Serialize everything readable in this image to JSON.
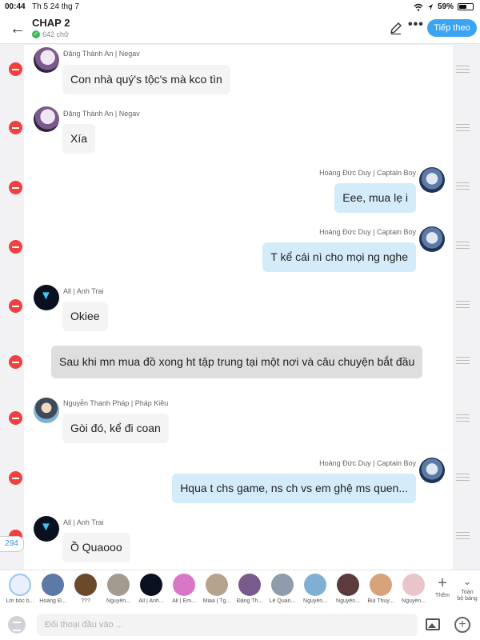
{
  "status_bar": {
    "time": "00:44",
    "date": "Th 5 24 thg 7",
    "battery": "59%",
    "battery_level": 0.59
  },
  "header": {
    "title": "CHAP 2",
    "word_count": "642 chữ",
    "next_button": "Tiếp theo",
    "back_icon": "back-arrow-icon",
    "edit_icon": "pencil-icon",
    "more_icon": "more-dots-icon"
  },
  "messages": [
    {
      "type": "incoming",
      "avatar": "av-a",
      "sender": "Đặng Thành An | Negav",
      "text": "Con nhà quý's tộc's mà kco tìn"
    },
    {
      "type": "incoming",
      "avatar": "av-a",
      "sender": "Đặng Thành An | Negav",
      "text": "Xía"
    },
    {
      "type": "outgoing",
      "avatar": "av-b",
      "sender": "Hoàng Đức Duy | Captain Boy",
      "text": "Eee, mua lẹ i"
    },
    {
      "type": "outgoing",
      "avatar": "av-b",
      "sender": "Hoàng Đức Duy | Captain Boy",
      "text": "T kể cái nì cho mọi ng nghe"
    },
    {
      "type": "incoming",
      "avatar": "av-c",
      "sender": "All | Anh Trai",
      "text": "Okiee"
    },
    {
      "type": "narration",
      "text": "Sau khi mn mua đồ xong ht tập trung tại một nơi và câu chuyện bắt đầu"
    },
    {
      "type": "incoming",
      "avatar": "av-d",
      "sender": "Nguyễn Thanh Pháp | Pháp Kiều",
      "text": "Gòi đó, kể đi coan"
    },
    {
      "type": "outgoing",
      "avatar": "av-b",
      "sender": "Hoàng Đức Duy | Captain Boy",
      "text": "Hqua t chs game, ns ch vs em ghệ ms quen..."
    },
    {
      "type": "incoming",
      "avatar": "av-c",
      "sender": "All | Anh Trai",
      "text": "Ồ Quaooo"
    }
  ],
  "counter": "294",
  "characters": [
    {
      "label": "Lời bốc b...",
      "color": "#e8f1fb"
    },
    {
      "label": "Hoàng Đ...",
      "color": "#5d79a5"
    },
    {
      "label": "???",
      "color": "#6b4a2a"
    },
    {
      "label": "Nguyễn...",
      "color": "#a39a90"
    },
    {
      "label": "All | Anh...",
      "color": "#0b1020"
    },
    {
      "label": "All | Em...",
      "color": "#d977c6"
    },
    {
      "label": "Miaa | Tg...",
      "color": "#b7a28e"
    },
    {
      "label": "Đặng Th...",
      "color": "#7a5a8a"
    },
    {
      "label": "Lê Quan...",
      "color": "#8e9cab"
    },
    {
      "label": "Nguyễn...",
      "color": "#7fb0d4"
    },
    {
      "label": "Nguyễn...",
      "color": "#5b3b3b"
    },
    {
      "label": "Bùi Thuỷ...",
      "color": "#d8a27a"
    },
    {
      "label": "Nguyễn...",
      "color": "#e9c4c8"
    }
  ],
  "add_character": {
    "label": "Thêm"
  },
  "all_characters": {
    "label_1": "Toàn",
    "label_2": "bộ bảng"
  },
  "input": {
    "placeholder": "Đối thoại đầu vào ..."
  }
}
